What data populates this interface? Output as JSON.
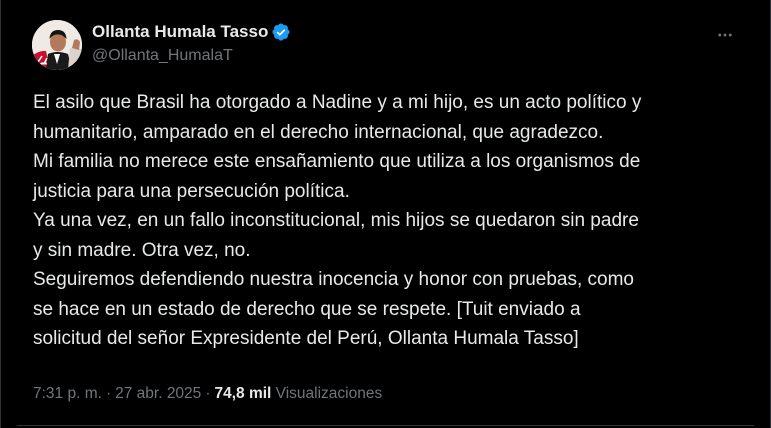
{
  "author": {
    "display_name": "Ollanta Humala Tasso",
    "handle": "@Ollanta_HumalaT",
    "verified": true,
    "verified_color": "#1d9bf0"
  },
  "tweet": {
    "lines": [
      "El asilo que Brasil ha otorgado a Nadine y a mi hijo, es un acto político y",
      "humanitario, amparado en el derecho internacional, que agradezco.",
      "Mi familia no merece este ensañamiento que utiliza a los organismos de",
      "justicia para una persecución política.",
      "Ya una vez, en un fallo inconstitucional, mis hijos se quedaron sin padre",
      "y sin madre. Otra vez, no.",
      "Seguiremos defendiendo nuestra inocencia y honor con pruebas, como",
      "se hace en un estado de derecho que se respete. [Tuit enviado a",
      "solicitud del señor Expresidente del Perú, Ollanta Humala Tasso]"
    ]
  },
  "meta": {
    "time": "7:31 p. m.",
    "separator": "·",
    "date": "27 abr. 2025",
    "views_count": "74,8 mil",
    "views_label": "Visualizaciones"
  },
  "icons": {
    "more": "more-horizontal-icon",
    "verified": "verified-badge-icon"
  },
  "colors": {
    "background": "#000000",
    "text_primary": "#e7e9ea",
    "text_secondary": "#71767b",
    "accent": "#1d9bf0"
  }
}
